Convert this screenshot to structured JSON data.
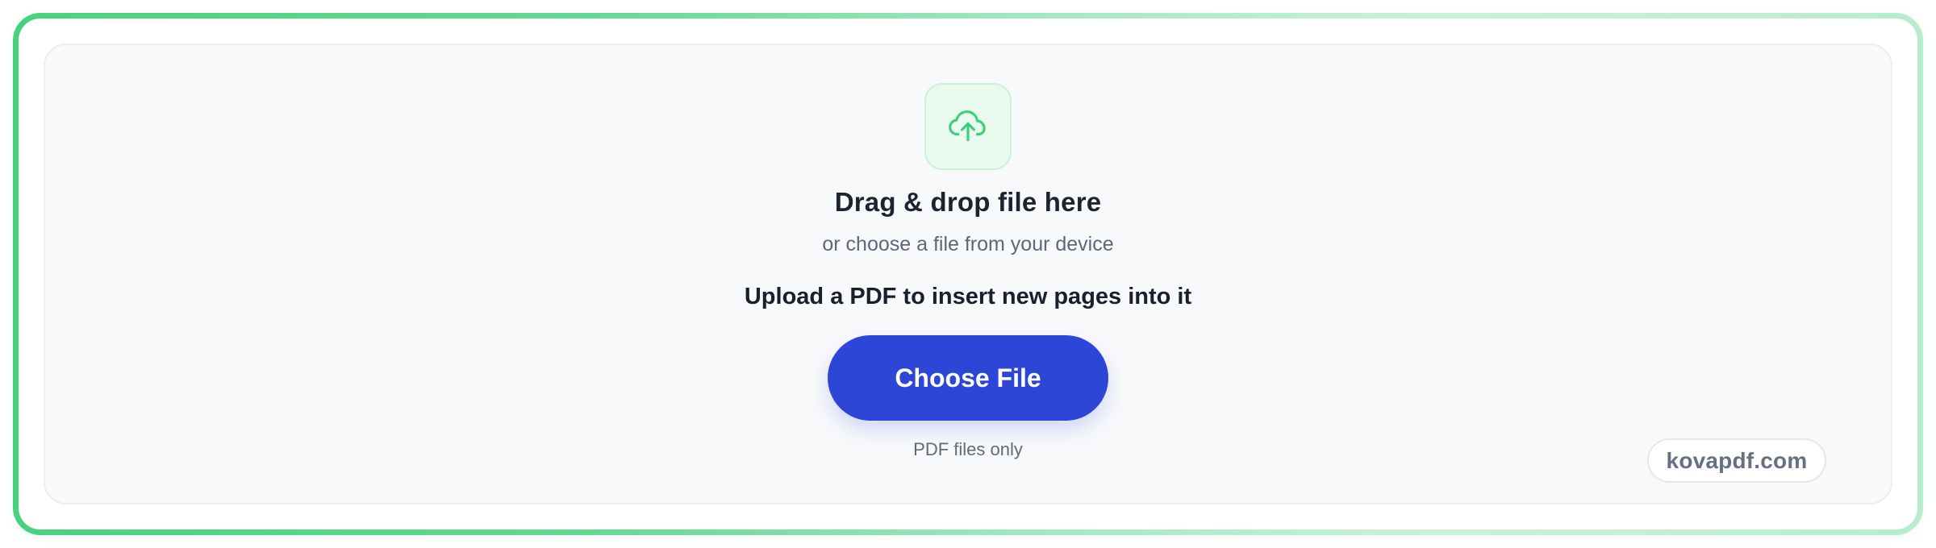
{
  "upload": {
    "title": "Drag & drop file here",
    "subtitle": "or choose a file from your device",
    "instruction": "Upload a PDF to insert new pages into it",
    "button_label": "Choose File",
    "file_hint": "PDF files only",
    "icon": "cloud-upload-icon"
  },
  "brand": {
    "watermark": "kovapdf.com"
  },
  "colors": {
    "primary_button": "#2E46D8",
    "accent_green": "#48D27F",
    "dropzone_background": "#F8F9FB",
    "title_text": "#1E2330",
    "muted_text": "#5F6675"
  }
}
